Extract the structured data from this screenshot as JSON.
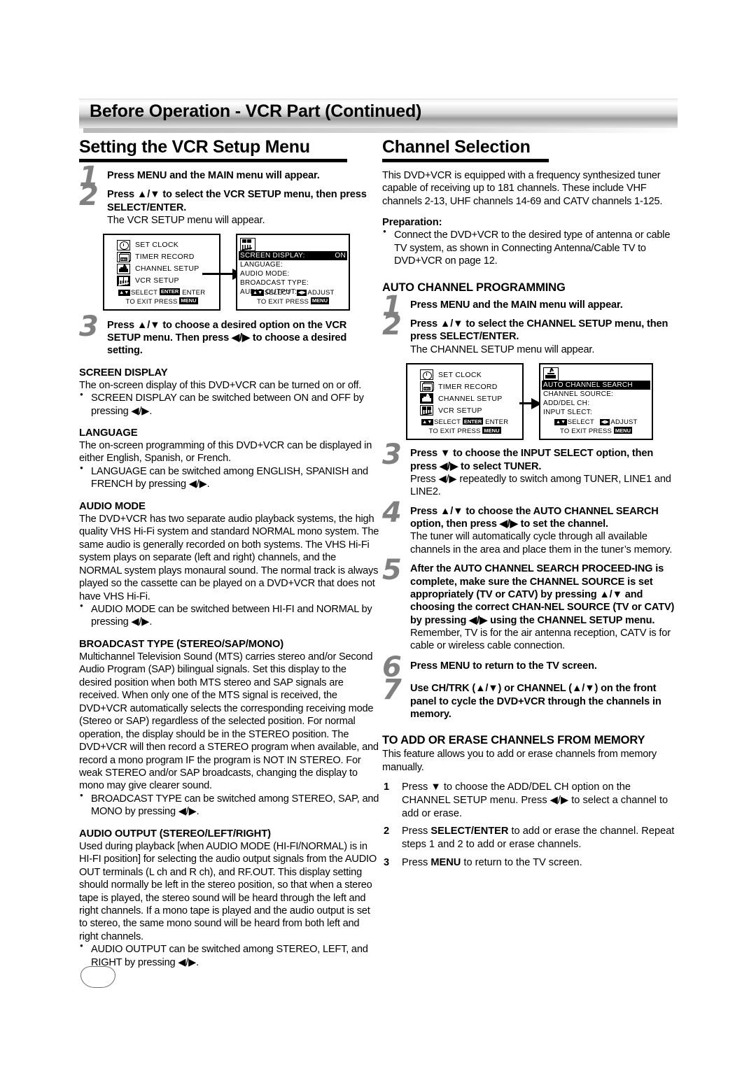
{
  "header": {
    "title": "Before Operation - VCR Part (Continued)"
  },
  "left_column": {
    "section_title": "Setting the VCR Setup Menu",
    "steps": [
      {
        "num": "1",
        "bold": "Press MENU and the MAIN menu will appear.",
        "normal": ""
      },
      {
        "num": "2",
        "bold": "Press ▲/▼ to select the VCR SETUP menu, then press SELECT/ENTER.",
        "normal": "The VCR SETUP menu will appear."
      },
      {
        "num": "3",
        "bold": "Press ▲/▼ to choose a desired option on the VCR SETUP menu. Then press ◀/▶ to choose a desired setting.",
        "normal": ""
      }
    ],
    "osd": {
      "main_menu": {
        "items": [
          {
            "label": "SET CLOCK",
            "icon": "clock-icon",
            "selected": false
          },
          {
            "label": "TIMER RECORD",
            "icon": "rec-tape-icon",
            "selected": false
          },
          {
            "label": "CHANNEL SETUP",
            "icon": "antenna-tv-icon",
            "selected": false
          },
          {
            "label": "VCR SETUP",
            "icon": "vcr-icon",
            "selected": true
          }
        ],
        "footer_line1_a": "SELECT",
        "footer_line1_key": "ENTER",
        "footer_line1_b": "ENTER",
        "footer_line2_a": "TO EXIT  PRESS",
        "footer_line2_key": "MENU"
      },
      "sub_menu": {
        "icon": "vcr-icon",
        "rows": [
          {
            "label": "SCREEN DISPLAY:",
            "value": "ON",
            "highlighted": true
          },
          {
            "label": "LANGUAGE:",
            "value": "",
            "highlighted": false
          },
          {
            "label": "AUDIO MODE:",
            "value": "",
            "highlighted": false
          },
          {
            "label": "BROADCAST TYPE:",
            "value": "",
            "highlighted": false
          },
          {
            "label": "AUDIO OUTPUT:",
            "value": "",
            "highlighted": false
          }
        ],
        "footer_line1_a": "SELECT",
        "footer_line1_b": "ADJUST",
        "footer_line2_a": "TO EXIT  PRESS",
        "footer_line2_key": "MENU"
      }
    },
    "subsections": [
      {
        "heading": "SCREEN DISPLAY",
        "body": "The on-screen display of this DVD+VCR can be turned on or off.",
        "bullets": [
          "SCREEN DISPLAY can be switched between ON and OFF by pressing ◀/▶."
        ]
      },
      {
        "heading": "LANGUAGE",
        "body": "The on-screen programming of this DVD+VCR can be displayed in either English, Spanish, or French.",
        "bullets": [
          "LANGUAGE can be switched among ENGLISH, SPANISH and FRENCH by pressing ◀/▶."
        ]
      },
      {
        "heading": "AUDIO MODE",
        "body": "The DVD+VCR has two separate audio playback systems, the high quality VHS Hi-Fi system and standard NORMAL mono system. The same audio is generally recorded on both systems. The VHS Hi-Fi system plays on separate (left and right) channels, and the NORMAL system plays monaural sound. The normal track is always played so the cassette can be played on a DVD+VCR that does not have VHS Hi-Fi.",
        "bullets": [
          "AUDIO MODE can be switched between HI-FI and NORMAL by pressing ◀/▶."
        ]
      },
      {
        "heading": "BROADCAST TYPE (STEREO/SAP/MONO)",
        "body": "Multichannel Television Sound (MTS) carries stereo and/or Second Audio Program (SAP) bilingual signals. Set this display to the desired position when both MTS stereo and SAP signals are received. When only one of the MTS signal is received, the DVD+VCR automatically selects the corresponding receiving mode (Stereo or SAP) regardless of the selected position. For normal operation, the display should be in the STEREO position. The DVD+VCR will then record a STEREO program when available, and record a mono program IF the program is NOT IN STEREO. For weak STEREO and/or SAP broadcasts, changing the display to mono may give clearer sound.",
        "bullets": [
          "BROADCAST TYPE can be switched among STEREO, SAP, and MONO by pressing ◀/▶."
        ]
      },
      {
        "heading": "AUDIO OUTPUT (STEREO/LEFT/RIGHT)",
        "body": "Used during playback [when AUDIO MODE (HI-FI/NORMAL) is in HI-FI position] for selecting the audio output signals from the AUDIO OUT terminals (L ch and R ch), and RF.OUT. This display setting should normally be left in the stereo position, so that when a stereo tape is played, the stereo sound will be heard through the left and right channels. If a mono tape is played and the audio output is set to stereo, the same mono sound will be heard from both left and right channels.",
        "bullets": [
          "AUDIO OUTPUT can be switched among STEREO, LEFT, and RIGHT by pressing ◀/▶."
        ]
      }
    ]
  },
  "right_column": {
    "section_title": "Channel Selection",
    "intro": "This DVD+VCR is equipped with a frequency synthesized tuner capable of receiving up to 181 channels. These include VHF channels 2-13, UHF channels 14-69 and CATV channels 1-125.",
    "preparation_heading": "Preparation:",
    "preparation_bullet": "Connect the DVD+VCR to the desired type of antenna or cable TV system, as shown in Connecting Antenna/Cable TV to DVD+VCR on page 12.",
    "auto_heading": "AUTO CHANNEL PROGRAMMING",
    "steps": [
      {
        "num": "1",
        "bold": "Press MENU and the MAIN menu will appear.",
        "normal": ""
      },
      {
        "num": "2",
        "bold": "Press ▲/▼ to select the CHANNEL SETUP menu, then press SELECT/ENTER.",
        "normal": "The CHANNEL SETUP menu will appear."
      },
      {
        "num": "3",
        "bold": "Press ▼ to choose the INPUT SELECT option, then press ◀/▶ to select TUNER.",
        "normal": "Press ◀/▶ repeatedly to switch among TUNER, LINE1 and LINE2."
      },
      {
        "num": "4",
        "bold": "Press ▲/▼ to choose the AUTO CHANNEL SEARCH option, then press ◀/▶ to set the channel.",
        "normal": "The tuner will automatically cycle through all available channels in the area and place them in the tuner’s memory."
      },
      {
        "num": "5",
        "bold": "After the AUTO CHANNEL SEARCH PROCEED-ING is complete, make sure the CHANNEL SOURCE is set appropriately (TV or CATV) by pressing ▲/▼ and choosing the correct CHAN-NEL SOURCE (TV or CATV) by pressing ◀/▶ using the CHANNEL SETUP menu.",
        "normal": "Remember, TV is for the air antenna reception, CATV is for cable or wireless  cable connection."
      },
      {
        "num": "6",
        "bold": "Press MENU to return to the TV screen.",
        "normal": ""
      },
      {
        "num": "7",
        "bold": "Use CH/TRK (▲/▼) or CHANNEL (▲/▼) on the front panel to cycle the DVD+VCR through the channels in memory.",
        "normal": ""
      }
    ],
    "osd": {
      "main_menu": {
        "items": [
          {
            "label": "SET CLOCK",
            "icon": "clock-icon",
            "selected": false
          },
          {
            "label": "TIMER RECORD",
            "icon": "rec-tape-icon",
            "selected": false
          },
          {
            "label": "CHANNEL SETUP",
            "icon": "antenna-tv-icon",
            "selected": true
          },
          {
            "label": "VCR SETUP",
            "icon": "vcr-icon",
            "selected": false
          }
        ],
        "footer_line1_a": "SELECT",
        "footer_line1_key": "ENTER",
        "footer_line1_b": "ENTER",
        "footer_line2_a": "TO EXIT  PRESS",
        "footer_line2_key": "MENU"
      },
      "sub_menu": {
        "icon": "antenna-tv-icon",
        "rows": [
          {
            "label": "AUTO CHANNEL SEARCH",
            "value": "",
            "highlighted": true
          },
          {
            "label": "CHANNEL SOURCE:",
            "value": "",
            "highlighted": false
          },
          {
            "label": "ADD/DEL CH:",
            "value": "",
            "highlighted": false
          },
          {
            "label": "INPUT SLECT:",
            "value": "",
            "highlighted": false
          }
        ],
        "footer_line1_a": "SELECT",
        "footer_line1_b": "ADJUST",
        "footer_line2_a": "TO EXIT  PRESS",
        "footer_line2_key": "MENU"
      }
    },
    "erase_heading": "TO ADD OR ERASE CHANNELS FROM MEMORY",
    "erase_body": "This feature allows you to add or erase channels from memory manually.",
    "erase_steps": [
      {
        "num": "1",
        "text_before": "Press ▼ to choose the ADD/DEL CH option on the CHANNEL SETUP menu. Press ◀/▶ to select a channel to add or erase.",
        "bold_part": "",
        "text_after": ""
      },
      {
        "num": "2",
        "text_before": "Press ",
        "bold_part": "SELECT/ENTER",
        "text_after": " to add or erase the channel. Repeat steps 1 and 2 to add or erase channels."
      },
      {
        "num": "3",
        "text_before": "Press ",
        "bold_part": "MENU",
        "text_after": " to return to the TV screen."
      }
    ]
  },
  "footer": {
    "page_number": ""
  }
}
